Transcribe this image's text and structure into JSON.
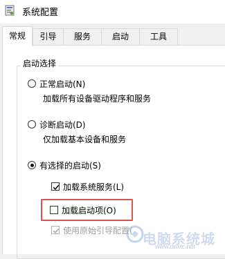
{
  "window": {
    "title": "系统配置",
    "icon": "system-config-icon"
  },
  "tabs": [
    {
      "label": "常规",
      "active": true
    },
    {
      "label": "引导",
      "active": false
    },
    {
      "label": "服务",
      "active": false
    },
    {
      "label": "启动",
      "active": false
    },
    {
      "label": "工具",
      "active": false
    }
  ],
  "startup_selection": {
    "group_title": "启动选择",
    "normal": {
      "label": "正常启动(N)",
      "description": "加载所有设备驱动程序和服务",
      "selected": false
    },
    "diagnostic": {
      "label": "诊断启动(D)",
      "description": "仅加载基本设备和服务",
      "selected": false
    },
    "selective": {
      "label": "有选择的启动(S)",
      "selected": true
    },
    "options": {
      "load_system_services": {
        "label": "加载系统服务(L)",
        "checked": true,
        "enabled": true
      },
      "load_startup_items": {
        "label": "加载启动项(O)",
        "checked": false,
        "enabled": true
      },
      "use_original_boot_config": {
        "label": "使用原始引导配置(",
        "checked": true,
        "enabled": false
      }
    }
  },
  "highlight_color": "#d9534f",
  "watermark": {
    "text": "电脑系统城",
    "url": "www.dnxtc.net"
  }
}
